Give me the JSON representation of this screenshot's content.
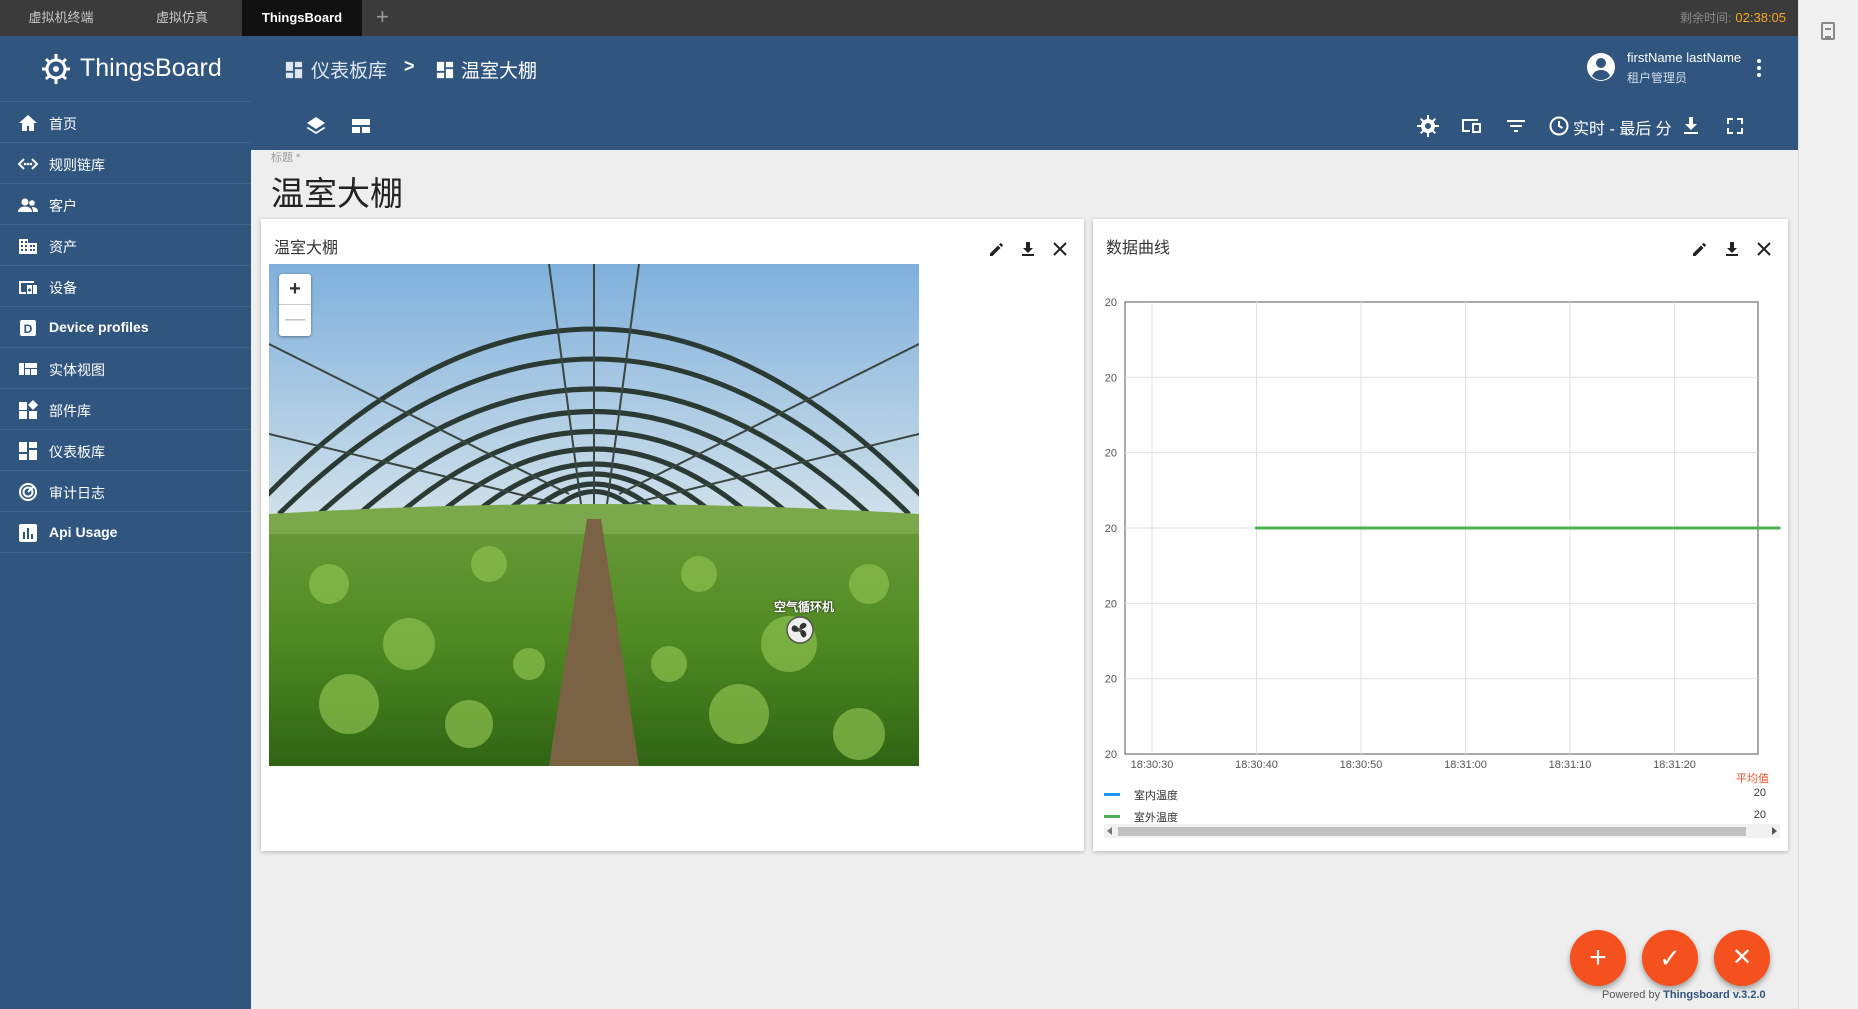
{
  "tabs": [
    {
      "label": "虚拟机终端"
    },
    {
      "label": "虚拟仿真"
    },
    {
      "label": "ThingsBoard",
      "active": true
    }
  ],
  "tab_add": "+",
  "timer": {
    "label": "剩余时间:",
    "value": "02:38:05"
  },
  "brand": {
    "name": "ThingsBoard"
  },
  "sidebar": {
    "items": [
      {
        "label": "首页",
        "icon": "home-icon"
      },
      {
        "label": "规则链库",
        "icon": "settings-ethernet-icon"
      },
      {
        "label": "客户",
        "icon": "supervisor-account-icon"
      },
      {
        "label": "资产",
        "icon": "domain-icon"
      },
      {
        "label": "设备",
        "icon": "devices-other-icon"
      },
      {
        "label": "Device profiles",
        "icon": "device-profile-icon"
      },
      {
        "label": "实体视图",
        "icon": "view-quilt-icon"
      },
      {
        "label": "部件库",
        "icon": "widgets-icon"
      },
      {
        "label": "仪表板库",
        "icon": "dashboards-icon"
      },
      {
        "label": "审计日志",
        "icon": "track-changes-icon"
      },
      {
        "label": "Api Usage",
        "icon": "insert-chart-icon"
      }
    ]
  },
  "breadcrumb": {
    "parent": "仪表板库",
    "separator": ">",
    "current": "温室大棚"
  },
  "user": {
    "name": "firstName lastName",
    "role": "租户管理员"
  },
  "toolbar": {
    "realtime_label": "实时 - 最后 分"
  },
  "dashboard": {
    "title_hint": "标题 *",
    "title": "温室大棚"
  },
  "map_widget": {
    "title": "温室大棚",
    "zoom_in": "+",
    "zoom_out": "—",
    "marker_label": "空气循环机"
  },
  "chart_widget": {
    "title": "数据曲线",
    "legend_header": "平均值",
    "legend": [
      {
        "name": "室内温度",
        "color": "#2196f3",
        "avg": "20"
      },
      {
        "name": "室外温度",
        "color": "#4caf50",
        "avg": "20"
      }
    ]
  },
  "chart_data": {
    "type": "line",
    "title": "",
    "xlabel": "",
    "ylabel": "",
    "x_ticks": [
      "18:30:30",
      "18:30:40",
      "18:30:50",
      "18:31:00",
      "18:31:10",
      "18:31:20"
    ],
    "y_ticks": [
      "20",
      "20",
      "20",
      "20",
      "20",
      "20",
      "20"
    ],
    "series": [
      {
        "name": "室内温度",
        "color": "#2196f3",
        "x": [
          "18:30:40",
          "18:31:30"
        ],
        "values": [
          20,
          20
        ]
      },
      {
        "name": "室外温度",
        "color": "#4caf50",
        "x": [
          "18:30:40",
          "18:31:30"
        ],
        "values": [
          20,
          20
        ]
      }
    ],
    "grid": true,
    "legend_position": "bottom"
  },
  "fabs": [
    {
      "label": "+",
      "icon": "add-icon"
    },
    {
      "label": "✓",
      "icon": "check-icon"
    },
    {
      "label": "✕",
      "icon": "close-icon"
    }
  ],
  "footer": {
    "prefix": "Powered by",
    "link": "Thingsboard v.3.2.0"
  },
  "colors": {
    "primary": "#305680",
    "accent": "#f4511e",
    "series_indoor": "#2196f3",
    "series_outdoor": "#4caf50"
  }
}
